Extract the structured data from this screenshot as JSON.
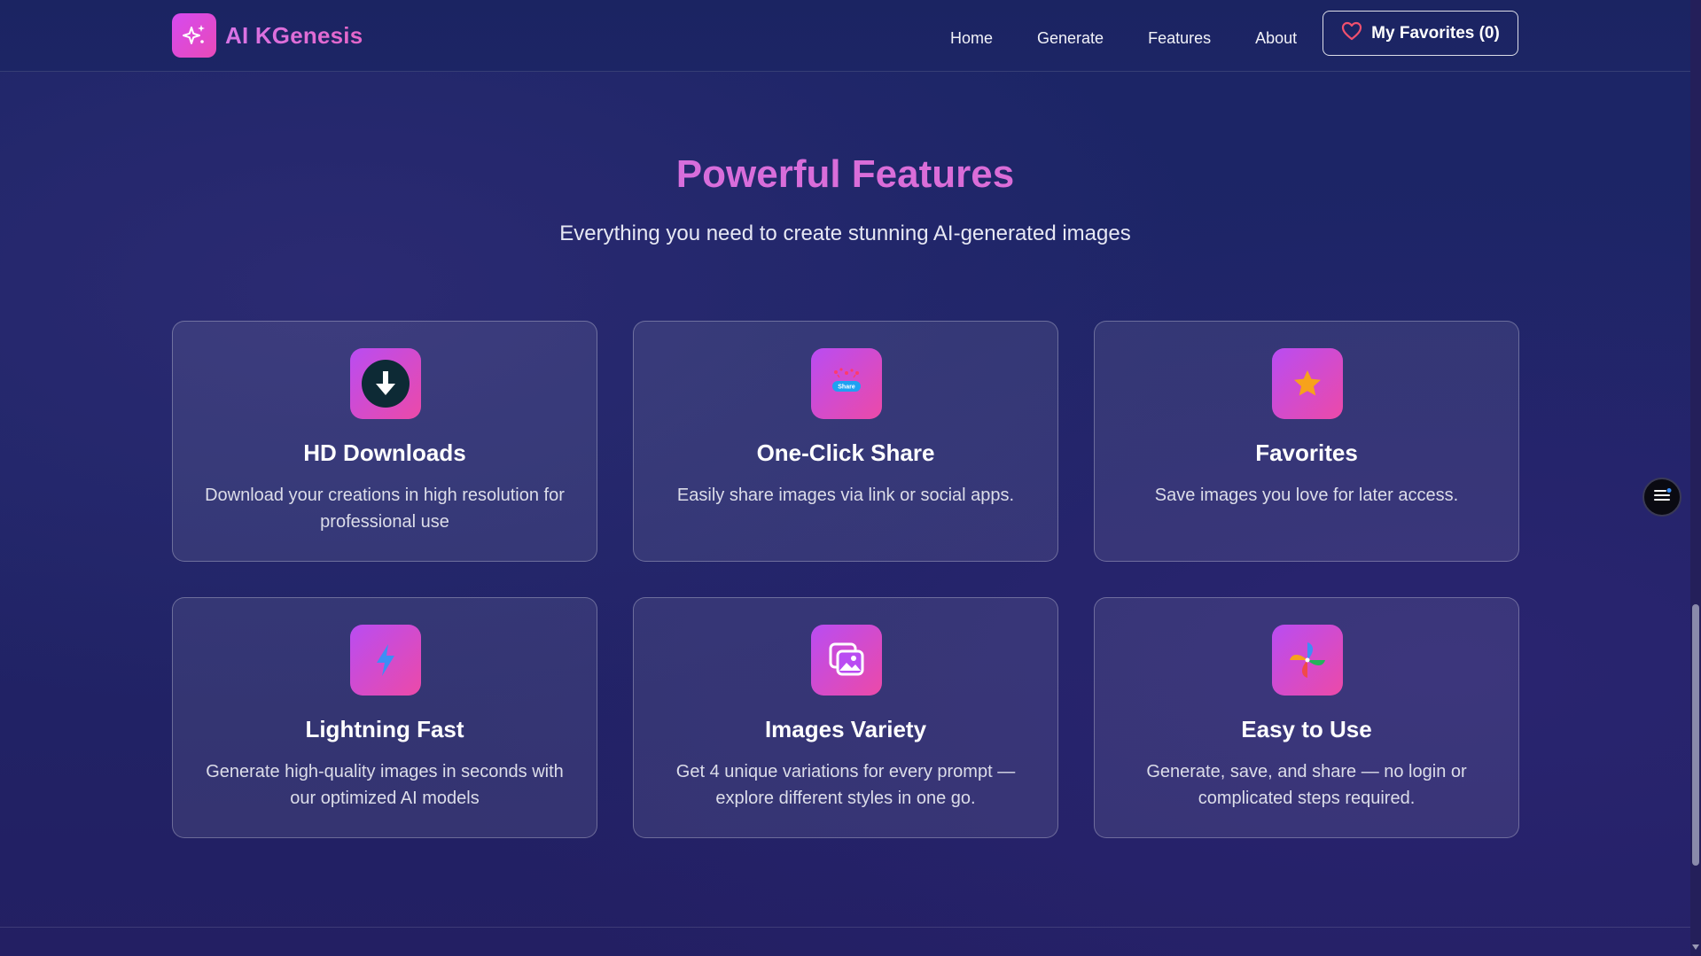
{
  "header": {
    "brand_name": "AI KGenesis",
    "nav": [
      "Home",
      "Generate",
      "Features",
      "About"
    ],
    "favorites_label": "My Favorites (0)"
  },
  "features": {
    "title": "Powerful Features",
    "subtitle": "Everything you need to create stunning AI-generated images",
    "cards": [
      {
        "icon": "download-icon",
        "title": "HD Downloads",
        "desc": "Download your creations in high resolution for professional use"
      },
      {
        "icon": "share-icon",
        "title": "One-Click Share",
        "desc": "Easily share images via link or social apps."
      },
      {
        "icon": "star-icon",
        "title": "Favorites",
        "desc": "Save images you love for later access."
      },
      {
        "icon": "lightning-icon",
        "title": "Lightning Fast",
        "desc": "Generate high-quality images in seconds with our optimized AI models"
      },
      {
        "icon": "images-icon",
        "title": "Images Variety",
        "desc": "Get 4 unique variations for every prompt — explore different styles in one go."
      },
      {
        "icon": "pinwheel-icon",
        "title": "Easy to Use",
        "desc": "Generate, save, and share — no login or complicated steps required."
      }
    ]
  },
  "share_icon_text": "Share",
  "colors": {
    "accent_gradient_start": "#b94cf2",
    "accent_gradient_end": "#ec4aa8",
    "title_pink": "#e06ad8",
    "background": "#1f2567"
  }
}
